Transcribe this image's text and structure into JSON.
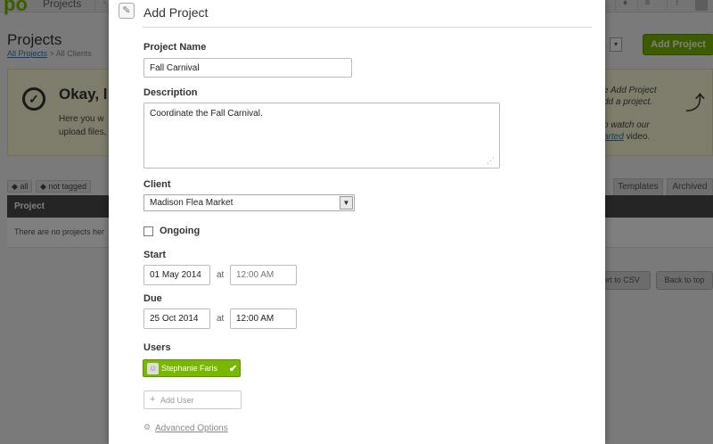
{
  "app": {
    "logo": "po",
    "nav_projects": "Projects"
  },
  "page": {
    "title": "Projects",
    "breadcrumb_link": "All Projects",
    "breadcrumb_rest": " > All Clients",
    "add_project_label": "Add Project"
  },
  "welcome": {
    "heading": "Okay, l",
    "line1": "Here you w",
    "line2": "upload files,",
    "right1": "e Add Project",
    "right2": "dd a project.",
    "right3": "o watch our",
    "right4_link": "arted",
    "right4_rest": " video."
  },
  "tags": [
    "all",
    "not tagged"
  ],
  "view_tabs": [
    "Templates",
    "Archived"
  ],
  "table": {
    "header": "Project",
    "empty": "There are no projects her"
  },
  "bottom_buttons": [
    "ort to CSV",
    "Back to top"
  ],
  "modal": {
    "title": "Add Project",
    "project_name_label": "Project Name",
    "project_name_value": "Fall Carnival",
    "description_label": "Description",
    "description_value": "Coordinate the Fall Carnival.",
    "client_label": "Client",
    "client_value": "Madison Flea Market",
    "ongoing_label": "Ongoing",
    "ongoing_checked": false,
    "start_label": "Start",
    "start_date": "01 May 2014",
    "start_at": "at",
    "start_time_placeholder": "12:00 AM",
    "due_label": "Due",
    "due_date": "25 Oct 2014",
    "due_at": "at",
    "due_time": "12:00 AM",
    "users_label": "Users",
    "user_chip": "Stephanie Faris",
    "add_user_placeholder": "Add User",
    "advanced_options": "Advanced Options"
  },
  "colors": {
    "accent_green": "#7ab800",
    "link_blue": "#2a7ab8",
    "overlay": "rgba(0,0,0,0.5)"
  },
  "icons": [
    "edit-icon",
    "check-circle-icon",
    "tag-icon",
    "chevron-down-icon",
    "user-avatar-icon",
    "checkmark-icon",
    "plus-icon",
    "gear-icon",
    "curly-arrow-icon",
    "resize-grip-icon"
  ]
}
